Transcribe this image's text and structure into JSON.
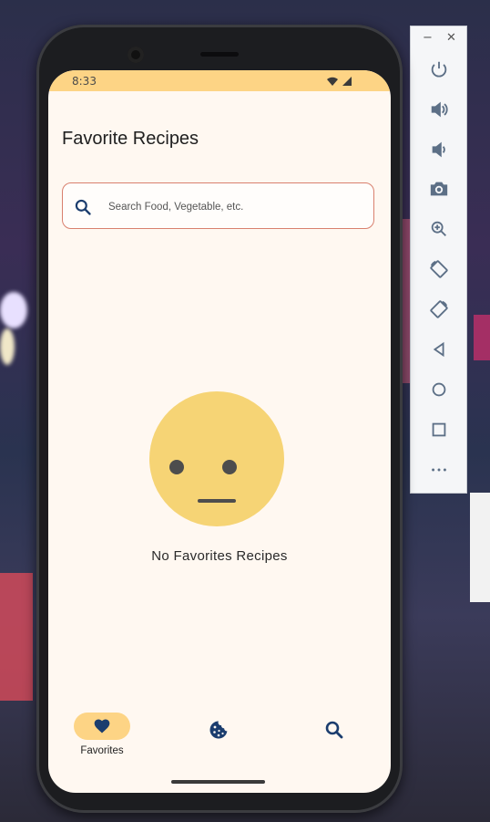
{
  "status_bar": {
    "time": "8:33",
    "wifi_icon": "wifi-icon",
    "signal_icon": "signal-icon"
  },
  "page": {
    "title": "Favorite Recipes"
  },
  "search": {
    "placeholder": "Search Food, Vegetable, etc.",
    "value": "",
    "icon": "search-icon"
  },
  "empty_state": {
    "icon": "neutral-face-icon",
    "message": "No Favorites Recipes"
  },
  "bottom_nav": {
    "items": [
      {
        "label": "Favorites",
        "icon": "heart-icon",
        "selected": true
      },
      {
        "label": "",
        "icon": "cookie-icon",
        "selected": false
      },
      {
        "label": "",
        "icon": "search-icon",
        "selected": false
      }
    ]
  },
  "emulator_toolbar": {
    "window_controls": {
      "minimize": "−",
      "close": "✕"
    },
    "buttons": [
      "power-icon",
      "volume-up-icon",
      "volume-down-icon",
      "camera-icon",
      "zoom-icon",
      "rotate-left-icon",
      "rotate-right-icon",
      "back-icon",
      "home-icon",
      "overview-icon",
      "more-icon"
    ]
  },
  "colors": {
    "accent": "#fdd485",
    "screen_bg": "#fff8f1",
    "search_border": "#d9806e",
    "icon_blue": "#1b3d6e",
    "face": "#f6d475"
  }
}
